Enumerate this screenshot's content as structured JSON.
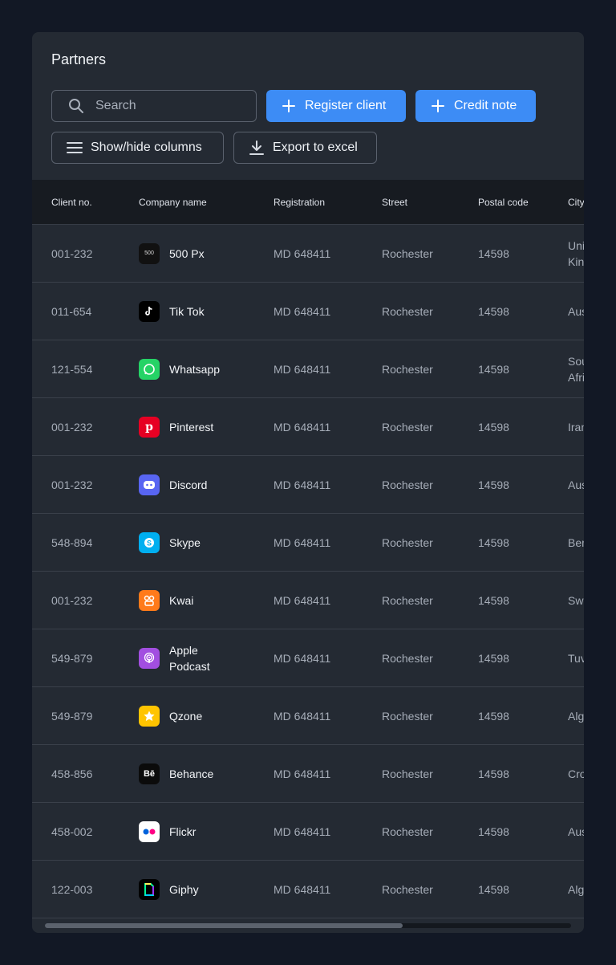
{
  "page": {
    "title": "Partners"
  },
  "toolbar": {
    "search_placeholder": "Search",
    "register_label": "Register client",
    "credit_label": "Credit note",
    "columns_label": "Show/hide columns",
    "export_label": "Export to excel"
  },
  "table": {
    "headers": [
      "Client no.",
      "Company name",
      "Registration",
      "Street",
      "Postal code",
      "City"
    ],
    "rows": [
      {
        "no": "001-232",
        "company": "500 Px",
        "logo": "500px",
        "color": "#111111",
        "reg": "MD 648411",
        "street": "Rochester",
        "postal": "14598",
        "city": "United Kingdom"
      },
      {
        "no": "011-654",
        "company": "Tik Tok",
        "logo": "tiktok",
        "color": "#000000",
        "reg": "MD 648411",
        "street": "Rochester",
        "postal": "14598",
        "city": "Australia"
      },
      {
        "no": "121-554",
        "company": "Whatsapp",
        "logo": "whatsapp",
        "color": "#25d366",
        "reg": "MD 648411",
        "street": "Rochester",
        "postal": "14598",
        "city": "South Africa"
      },
      {
        "no": "001-232",
        "company": "Pinterest",
        "logo": "pinterest",
        "color": "#e60023",
        "reg": "MD 648411",
        "street": "Rochester",
        "postal": "14598",
        "city": "Iran"
      },
      {
        "no": "001-232",
        "company": "Discord",
        "logo": "discord",
        "color": "#5865f2",
        "reg": "MD 648411",
        "street": "Rochester",
        "postal": "14598",
        "city": "Austria"
      },
      {
        "no": "548-894",
        "company": "Skype",
        "logo": "skype",
        "color": "#00aff0",
        "reg": "MD 648411",
        "street": "Rochester",
        "postal": "14598",
        "city": "Benin"
      },
      {
        "no": "001-232",
        "company": "Kwai",
        "logo": "kwai",
        "color": "#ff7a1a",
        "reg": "MD 648411",
        "street": "Rochester",
        "postal": "14598",
        "city": "Sweden"
      },
      {
        "no": "549-879",
        "company": "Apple Podcast",
        "logo": "podcast",
        "color": "#a24ee0",
        "reg": "MD 648411",
        "street": "Rochester",
        "postal": "14598",
        "city": "Tuvalu"
      },
      {
        "no": "549-879",
        "company": "Qzone",
        "logo": "qzone",
        "color": "#ffc400",
        "reg": "MD 648411",
        "street": "Rochester",
        "postal": "14598",
        "city": "Algeria"
      },
      {
        "no": "458-856",
        "company": "Behance",
        "logo": "behance",
        "color": "#0b0b0b",
        "reg": "MD 648411",
        "street": "Rochester",
        "postal": "14598",
        "city": "Croatia"
      },
      {
        "no": "458-002",
        "company": "Flickr",
        "logo": "flickr",
        "color": "#ffffff",
        "reg": "MD 648411",
        "street": "Rochester",
        "postal": "14598",
        "city": "Austria"
      },
      {
        "no": "122-003",
        "company": "Giphy",
        "logo": "giphy",
        "color": "#000000",
        "reg": "MD 648411",
        "street": "Rochester",
        "postal": "14598",
        "city": "Algeria"
      }
    ]
  },
  "scroll": {
    "horizontal_position": 0.0,
    "visible_fraction": 0.68
  }
}
